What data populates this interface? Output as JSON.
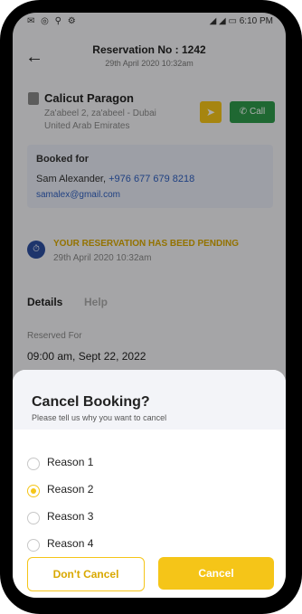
{
  "status_bar": {
    "left_icons": "✉ ◎ ⚲ ⚙",
    "time": "6:10 PM",
    "right_icons": "◢ ◢ ▭"
  },
  "header": {
    "title": "Reservation No : 1242",
    "date": "29th April 2020 10:32am"
  },
  "hotel": {
    "name": "Calicut Paragon",
    "address_line1": "Za'abeel 2, za'abeel - Dubai",
    "address_line2": "United Arab Emirates",
    "call_label": "Call"
  },
  "booking": {
    "label": "Booked for",
    "name": "Sam Alexander,",
    "phone": "+976 677 679 8218",
    "email": "samalex@gmail.com"
  },
  "status": {
    "message": "YOUR RESERVATION HAS BEED PENDING",
    "date": "29th April 2020 10:32am"
  },
  "tabs": [
    "Details",
    "Help"
  ],
  "reservation": {
    "label": "Reserved For",
    "value": "09:00 am, Sept 22, 2022"
  },
  "sheet": {
    "title": "Cancel Booking?",
    "subtitle": "Please tell us why you want to cancel",
    "reasons": [
      "Reason 1",
      "Reason 2",
      "Reason 3",
      "Reason 4"
    ],
    "selected_reason": "Reason 2",
    "dont_cancel_label": "Don't Cancel",
    "cancel_label": "Cancel"
  },
  "colors": {
    "accent": "#f5c518",
    "call_green": "#2e9a4a",
    "link_blue": "#3060c0"
  }
}
